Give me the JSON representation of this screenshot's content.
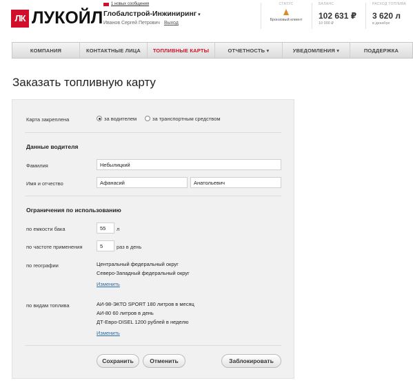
{
  "brand": {
    "logo_mark": "ЛК",
    "logo_text": "ЛУКОЙЛ",
    "accent_color": "#d0102b"
  },
  "header": {
    "notifications": "1 новых сообщения",
    "company": "Глобалстрой-Инжиниринг",
    "company_caret": "▾",
    "user_name": "Иванов Сергей Петрович",
    "logout": "Выход",
    "status_caption": "СТАТУС",
    "status_label": "Бронзовый клиент",
    "balance_caption": "БАЛАНС",
    "balance_value": "102 631 ₽",
    "balance_sub": "10 000 ₽",
    "fuel_caption": "РАСХОД ТОПЛИВА",
    "fuel_value": "3 620 л",
    "fuel_sub": "в декабре"
  },
  "nav": {
    "items": [
      {
        "label": "КОМПАНИЯ"
      },
      {
        "label": "КОНТАКТНЫЕ ЛИЦА"
      },
      {
        "label": "ТОПЛИВНЫЕ КАРТЫ"
      },
      {
        "label": "ОТЧЕТНОСТЬ ▾"
      },
      {
        "label": "УВЕДОМЛЕНИЯ ▾"
      },
      {
        "label": "ПОДДЕРЖКА"
      }
    ],
    "active_index": 2
  },
  "page": {
    "title": "Заказать топливную карту"
  },
  "form": {
    "card_bound_label": "Карта закреплена",
    "radio_driver": "за водителем",
    "radio_vehicle": "за транспортным средством",
    "selected": "за водителем",
    "driver_section": "Данные водителя",
    "surname_label": "Фамилия",
    "surname_value": "Небылицкий",
    "name_label": "Имя и отчество",
    "first_name_value": "Афанасий",
    "patronymic_value": "Анатольевич",
    "limits_section": "Ограничения по использованию",
    "tank_label": "по емкости бака",
    "tank_value": "55",
    "tank_unit": "л",
    "freq_label": "по частоте применения",
    "freq_value": "5",
    "freq_unit": "раз в день",
    "geo_label": "по географии",
    "geo_items": [
      "Центральный федеральный округ",
      "Северо-Западный федеральный округ"
    ],
    "geo_change": "Изменить",
    "fuel_label": "по видам топлива",
    "fuel_items": [
      "АИ-98-ЭКТО SPORT  180  литров в месяц",
      "АИ-80  60  литров в день",
      "ДТ-Евро-DISEL  1200  рублей в неделю"
    ],
    "fuel_change": "Изменить"
  },
  "buttons": {
    "save": "Сохранить",
    "cancel": "Отменить",
    "block": "Заблокировать"
  }
}
